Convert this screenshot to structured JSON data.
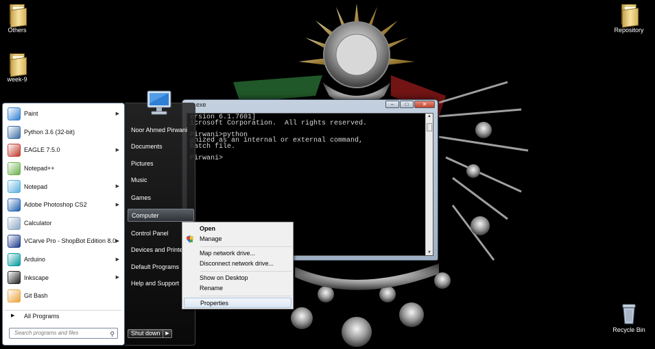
{
  "desktop": {
    "icons": [
      {
        "label": "Others"
      },
      {
        "label": "week-9"
      },
      {
        "label": "Repository"
      },
      {
        "label": "Recycle Bin"
      }
    ]
  },
  "console": {
    "title": "exe",
    "lines": [
      "ersion 6.1.7601]",
      "icrosoft Corporation.  All rights reserved.",
      "",
      "Pirwani>python",
      "gnized as an internal or external command,",
      "batch file.",
      "",
      "Pirwani>"
    ]
  },
  "start_menu": {
    "programs": [
      {
        "label": "Paint",
        "has_submenu": true,
        "icon": "paint-icon",
        "color": "#2f7fd0"
      },
      {
        "label": "Python 3.6 (32-bit)",
        "has_submenu": false,
        "icon": "python-icon",
        "color": "#3b6ea5"
      },
      {
        "label": "EAGLE 7.5.0",
        "has_submenu": true,
        "icon": "eagle-icon",
        "color": "#c0392b"
      },
      {
        "label": "Notepad++",
        "has_submenu": false,
        "icon": "notepadpp-icon",
        "color": "#6ab04c"
      },
      {
        "label": "Notepad",
        "has_submenu": true,
        "icon": "notepad-icon",
        "color": "#5ab0e0"
      },
      {
        "label": "Adobe Photoshop CS2",
        "has_submenu": true,
        "icon": "photoshop-icon",
        "color": "#1f5fae"
      },
      {
        "label": "Calculator",
        "has_submenu": false,
        "icon": "calculator-icon",
        "color": "#8aa7c4"
      },
      {
        "label": "VCarve Pro - ShopBot Edition 8.0",
        "has_submenu": true,
        "icon": "vcarve-icon",
        "color": "#1b3a8c"
      },
      {
        "label": "Arduino",
        "has_submenu": true,
        "icon": "arduino-icon",
        "color": "#00979c"
      },
      {
        "label": "Inkscape",
        "has_submenu": true,
        "icon": "inkscape-icon",
        "color": "#222222"
      },
      {
        "label": "Git Bash",
        "has_submenu": false,
        "icon": "git-bash-icon",
        "color": "#e9a23b"
      }
    ],
    "all_programs": "All Programs",
    "search_placeholder": "Search programs and files",
    "right_items": [
      {
        "label": "Noor Ahmed Pirwani"
      },
      {
        "label": "Documents"
      },
      {
        "label": "Pictures"
      },
      {
        "label": "Music"
      },
      {
        "label": "Games"
      },
      {
        "label": "Computer"
      },
      {
        "label": "Control Panel"
      },
      {
        "label": "Devices and Printers"
      },
      {
        "label": "Default Programs"
      },
      {
        "label": "Help and Support"
      }
    ],
    "shutdown_label": "Shut down"
  },
  "context_menu": {
    "items": [
      {
        "label": "Open"
      },
      {
        "label": "Manage"
      },
      {
        "label": "Map network drive..."
      },
      {
        "label": "Disconnect network drive..."
      },
      {
        "label": "Show on Desktop"
      },
      {
        "label": "Rename"
      },
      {
        "label": "Properties"
      }
    ]
  }
}
